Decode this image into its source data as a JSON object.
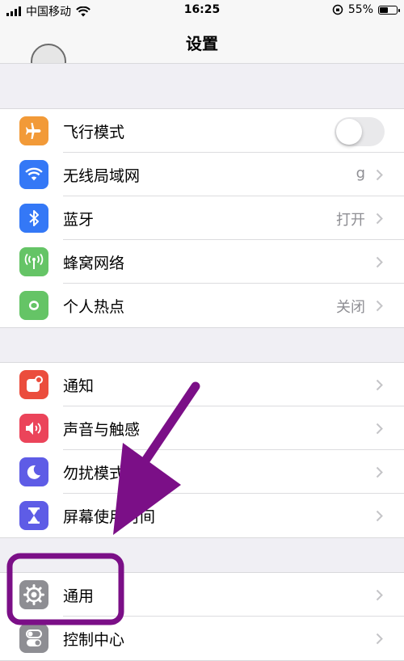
{
  "status_bar": {
    "carrier": "中国移动",
    "time": "16:25",
    "battery": "55%",
    "battery_level": 0.55,
    "icons": [
      "signal-icon",
      "wifi-icon",
      "orientation-lock-icon",
      "battery-icon"
    ]
  },
  "nav": {
    "title": "设置"
  },
  "groups": [
    {
      "rows": [
        {
          "label": "飞行模式",
          "icon": "airplane-icon",
          "color": "#f29a38",
          "toggle_on": false
        },
        {
          "label": "无线局域网",
          "icon": "wifi-icon",
          "color": "#3478f6",
          "value": "g"
        },
        {
          "label": "蓝牙",
          "icon": "bluetooth-icon",
          "color": "#3478f6",
          "value": "打开"
        },
        {
          "label": "蜂窝网络",
          "icon": "cellular-icon",
          "color": "#65c466"
        },
        {
          "label": "个人热点",
          "icon": "hotspot-icon",
          "color": "#65c466",
          "value": "关闭"
        }
      ]
    },
    {
      "rows": [
        {
          "label": "通知",
          "icon": "notifications-icon",
          "color": "#eb4d3d"
        },
        {
          "label": "声音与触感",
          "icon": "sound-icon",
          "color": "#eb445a"
        },
        {
          "label": "勿扰模式",
          "icon": "moon-icon",
          "color": "#5e5ce6"
        },
        {
          "label": "屏幕使用时间",
          "icon": "hourglass-icon",
          "color": "#5e5ce6"
        }
      ]
    },
    {
      "rows": [
        {
          "label": "通用",
          "icon": "gear-icon",
          "color": "#8e8e93"
        },
        {
          "label": "控制中心",
          "icon": "toggles-icon",
          "color": "#8e8e93"
        }
      ]
    }
  ],
  "annotation": {
    "arrow_color": "#7b0f87",
    "highlight_color": "#7b0f87",
    "highlights": "通用"
  }
}
